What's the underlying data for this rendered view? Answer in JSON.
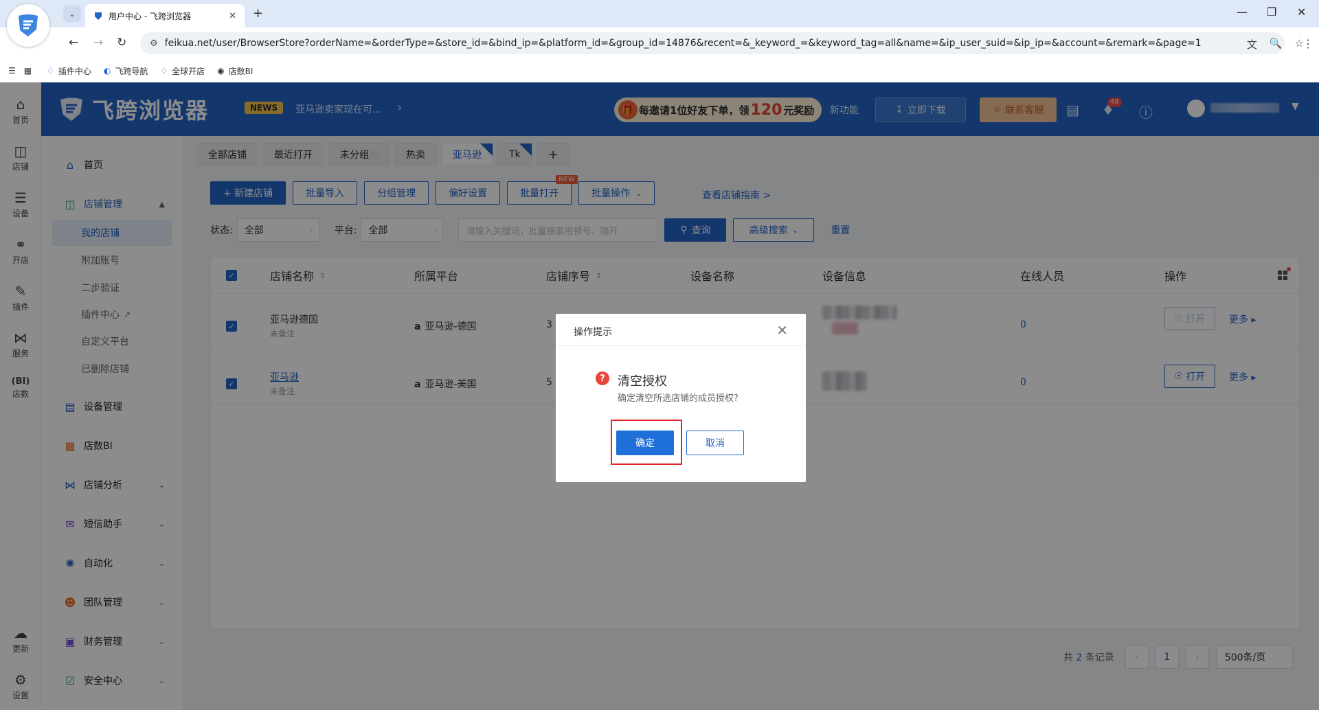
{
  "browser": {
    "tab_title": "用户中心 - 飞跨浏览器",
    "url": "feikua.net/user/BrowserStore?orderName=&orderType=&store_id=&bind_ip=&platform_id=&group_id=14876&recent=&_keyword_=&keyword_tag=all&name=&ip_user_suid=&ip_ip=&account=&remark=&page=1",
    "bookmarks": [
      "插件中心",
      "飞跨导航",
      "全球开店",
      "店数BI"
    ]
  },
  "header": {
    "brand": "飞跨浏览器",
    "news_tag": "NEWS",
    "news_text": "亚马逊卖家现在可...",
    "invite_pre": "每邀请1位好友下单，领",
    "invite_amount": "120",
    "invite_post": "元奖励",
    "new_feature": "新功能",
    "download": "立即下载",
    "contact": "联系客服",
    "bell_count": "48"
  },
  "iconbar": [
    {
      "label": "首页",
      "icon": "home-icon"
    },
    {
      "label": "店铺",
      "icon": "store-icon"
    },
    {
      "label": "设备",
      "icon": "layers-icon"
    },
    {
      "label": "开店",
      "icon": "planet-icon"
    },
    {
      "label": "插件",
      "icon": "puzzle-icon"
    },
    {
      "label": "服务",
      "icon": "grid-icon"
    },
    {
      "label": "店数",
      "icon": "bi-icon"
    },
    {
      "label": "更新",
      "icon": "cloud-icon"
    },
    {
      "label": "设置",
      "icon": "gear-icon"
    }
  ],
  "sidemenu": {
    "home": "首页",
    "store_mgmt": "店铺管理",
    "subs": [
      "我的店铺",
      "附加账号",
      "二步验证",
      "插件中心",
      "自定义平台",
      "已删除店铺"
    ],
    "device_mgmt": "设备管理",
    "bi": "店数BI",
    "analysis": "店铺分析",
    "sms": "短信助手",
    "automation": "自动化",
    "team": "团队管理",
    "finance": "财务管理",
    "security": "安全中心"
  },
  "tabs": [
    "全部店铺",
    "最近打开",
    "未分组",
    "热卖",
    "亚马逊",
    "Tk",
    "+"
  ],
  "toolbar": {
    "new_store": "+ 新建店铺",
    "batch_import": "批量导入",
    "group_mgmt": "分组管理",
    "prefs": "偏好设置",
    "batch_open": "批量打开",
    "new_badge": "NEW",
    "batch_ops": "批量操作",
    "guide": "查看店铺指南 >"
  },
  "filter": {
    "status_label": "状态:",
    "status_value": "全部",
    "platform_label": "平台:",
    "platform_value": "全部",
    "keyword_placeholder": "请输入关键词，批量搜索用顿号、隔开",
    "query": "查询",
    "advanced": "高级搜索",
    "reset": "重置"
  },
  "table": {
    "headers": [
      "店铺名称",
      "所属平台",
      "店铺序号",
      "设备名称",
      "设备信息",
      "在线人员",
      "操作"
    ],
    "rows": [
      {
        "name": "亚马逊德国",
        "remark": "未备注",
        "platform": "亚马逊-德国",
        "seq": "3",
        "online": "0",
        "open": "打开",
        "more": "更多"
      },
      {
        "name": "亚马逊",
        "remark": "未备注",
        "platform": "亚马逊-美国",
        "seq": "5",
        "online": "0",
        "open": "打开",
        "more": "更多"
      }
    ]
  },
  "pager": {
    "total_pre": "共",
    "total_count": "2",
    "total_post": "条记录",
    "current": "1",
    "size": "500条/页"
  },
  "modal": {
    "title": "操作提示",
    "heading": "清空授权",
    "message": "确定清空所选店铺的成员授权?",
    "confirm": "确定",
    "cancel": "取消"
  },
  "colors": {
    "primary": "#2465c6",
    "danger": "#e3262c",
    "header_bg": "#2465c6"
  }
}
